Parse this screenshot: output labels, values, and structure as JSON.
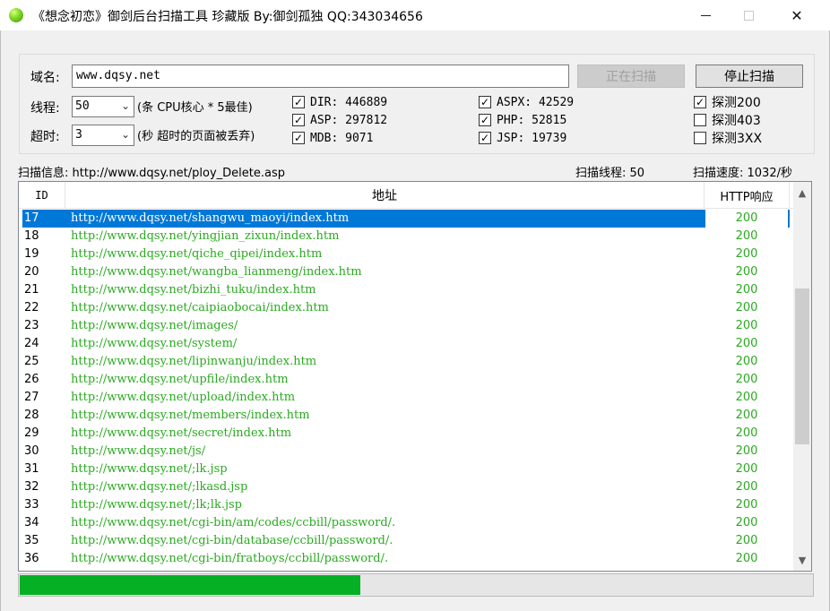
{
  "window": {
    "title": "《想念初恋》御剑后台扫描工具 珍藏版 By:御剑孤独 QQ:343034656",
    "minimize_icon": "minimize-icon",
    "maximize_icon": "maximize-icon",
    "close_glyph": "✕"
  },
  "form": {
    "domain_label": "域名:",
    "domain_value": "www.dqsy.net",
    "scan_button": "正在扫描",
    "stop_button": "停止扫描",
    "threads_label": "线程:",
    "threads_value": "50",
    "threads_hint": "(条 CPU核心 * 5最佳)",
    "timeout_label": "超时:",
    "timeout_value": "3",
    "timeout_hint": "(秒 超时的页面被丢弃)"
  },
  "dictionaries": [
    {
      "label": "DIR: 446889",
      "checked": true
    },
    {
      "label": "ASP: 297812",
      "checked": true
    },
    {
      "label": "MDB: 9071",
      "checked": true
    },
    {
      "label": "ASPX: 42529",
      "checked": true
    },
    {
      "label": "PHP: 52815",
      "checked": true
    },
    {
      "label": "JSP: 19739",
      "checked": true
    }
  ],
  "detect": [
    {
      "label": "探测200",
      "checked": true
    },
    {
      "label": "探测403",
      "checked": false
    },
    {
      "label": "探测3XX",
      "checked": false
    }
  ],
  "status": {
    "info": "扫描信息: http://www.dqsy.net/ploy_Delete.asp",
    "threads": "扫描线程: 50",
    "speed": "扫描速度: 1032/秒"
  },
  "table": {
    "headers": {
      "id": "ID",
      "url": "地址",
      "http": "HTTP响应"
    },
    "selected_index": 0,
    "rows": [
      {
        "id": "17",
        "url": "http://www.dqsy.net/shangwu_maoyi/index.htm",
        "http": "200"
      },
      {
        "id": "18",
        "url": "http://www.dqsy.net/yingjian_zixun/index.htm",
        "http": "200"
      },
      {
        "id": "19",
        "url": "http://www.dqsy.net/qiche_qipei/index.htm",
        "http": "200"
      },
      {
        "id": "20",
        "url": "http://www.dqsy.net/wangba_lianmeng/index.htm",
        "http": "200"
      },
      {
        "id": "21",
        "url": "http://www.dqsy.net/bizhi_tuku/index.htm",
        "http": "200"
      },
      {
        "id": "22",
        "url": "http://www.dqsy.net/caipiaobocai/index.htm",
        "http": "200"
      },
      {
        "id": "23",
        "url": "http://www.dqsy.net/images/",
        "http": "200"
      },
      {
        "id": "24",
        "url": "http://www.dqsy.net/system/",
        "http": "200"
      },
      {
        "id": "25",
        "url": "http://www.dqsy.net/lipinwanju/index.htm",
        "http": "200"
      },
      {
        "id": "26",
        "url": "http://www.dqsy.net/upfile/index.htm",
        "http": "200"
      },
      {
        "id": "27",
        "url": "http://www.dqsy.net/upload/index.htm",
        "http": "200"
      },
      {
        "id": "28",
        "url": "http://www.dqsy.net/members/index.htm",
        "http": "200"
      },
      {
        "id": "29",
        "url": "http://www.dqsy.net/secret/index.htm",
        "http": "200"
      },
      {
        "id": "30",
        "url": "http://www.dqsy.net/js/",
        "http": "200"
      },
      {
        "id": "31",
        "url": "http://www.dqsy.net/;lk.jsp",
        "http": "200"
      },
      {
        "id": "32",
        "url": "http://www.dqsy.net/;lkasd.jsp",
        "http": "200"
      },
      {
        "id": "33",
        "url": "http://www.dqsy.net/;lk;lk.jsp",
        "http": "200"
      },
      {
        "id": "34",
        "url": "http://www.dqsy.net/cgi-bin/am/codes/ccbill/password/.",
        "http": "200"
      },
      {
        "id": "35",
        "url": "http://www.dqsy.net/cgi-bin/database/ccbill/password/.",
        "http": "200"
      },
      {
        "id": "36",
        "url": "http://www.dqsy.net/cgi-bin/fratboys/ccbill/password/.",
        "http": "200"
      }
    ]
  },
  "scrollbar": {
    "position": 0.45,
    "visible_fraction": 0.45
  },
  "progress": {
    "fraction": 0.43
  },
  "colors": {
    "url_text": "#2aaa20",
    "selection": "#0078d7",
    "progress": "#06b025"
  }
}
